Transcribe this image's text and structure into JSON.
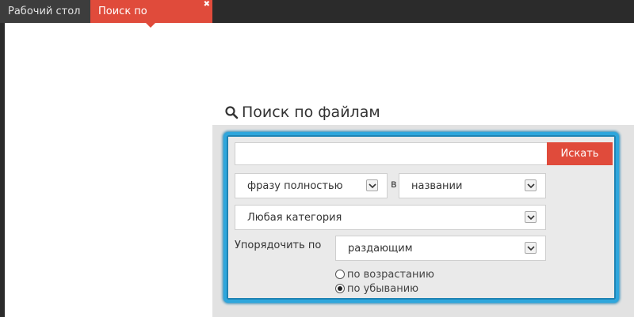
{
  "tabs": [
    {
      "label": "Рабочий стол",
      "active": false
    },
    {
      "label": "Поиск по торрентам",
      "active": true,
      "close_glyph": "✖"
    }
  ],
  "search": {
    "heading": "Поиск по файлам",
    "heading_icon": "search-icon",
    "input_value": "",
    "button_label": "Искать",
    "match_mode": "фразу полностью",
    "in_label": "в",
    "search_in": "названии",
    "category": "Любая категория",
    "order_label": "Упорядочить по",
    "order_by": "раздающим",
    "sort_options": [
      {
        "label": "по возрастанию",
        "checked": false
      },
      {
        "label": "по убыванию",
        "checked": true
      }
    ]
  },
  "colors": {
    "accent": "#e04b3b",
    "highlight": "#2ea6dc",
    "tabbar": "#2b2b2b"
  }
}
